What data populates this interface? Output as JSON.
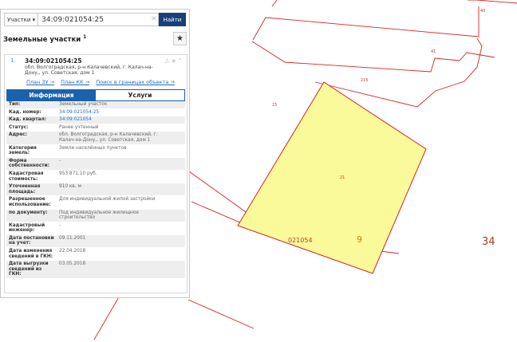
{
  "search": {
    "type_label": "Участки ▾",
    "query": "34:09:021054:25",
    "clear_glyph": "×",
    "find_label": "Найти"
  },
  "panel": {
    "title": "Земельные участки",
    "title_sup": "1",
    "star_glyph": "★"
  },
  "result": {
    "index": "1.",
    "cadastral_number": "34:09:021054:25",
    "address_lines": [
      "обл. Волгоградская, р-н Калачевский, г. Калач-на-",
      "Дону,, ул. Советская, дом 1"
    ],
    "action_icons": "⚠★⌃",
    "links": [
      "План ЗУ →",
      "План КК →",
      "Поиск в границах объекта →"
    ]
  },
  "tabs": [
    {
      "label": "Информация",
      "active": true
    },
    {
      "label": "Услуги",
      "active": false
    }
  ],
  "attributes": [
    {
      "key": [
        "Тип:"
      ],
      "value": [
        "Земельный участок"
      ],
      "link": false
    },
    {
      "key": [
        "Кад. номер:"
      ],
      "value": [
        "34:09:021054:25"
      ],
      "link": true
    },
    {
      "key": [
        "Кад. квартал:"
      ],
      "value": [
        "34:09:021054"
      ],
      "link": true
    },
    {
      "key": [
        "Статус:"
      ],
      "value": [
        "Ранее учтенный"
      ],
      "link": false
    },
    {
      "key": [
        "Адрес:"
      ],
      "value": [
        "обл. Волгоградская, р-н Калачевский, г.",
        "Калач-на-Дону,, ул. Советская, дом 1"
      ],
      "link": false
    },
    {
      "key": [
        "Категория земель:"
      ],
      "value": [
        "Земли населённых пунктов"
      ],
      "link": false
    },
    {
      "key": [
        "Форма",
        "собственности:"
      ],
      "value": [
        "-"
      ],
      "link": false
    },
    {
      "key": [
        "Кадастровая",
        "стоимость:"
      ],
      "value": [
        "953 871,10 руб."
      ],
      "link": false
    },
    {
      "key": [
        "Уточненная",
        "площадь:"
      ],
      "value": [
        "910 кв. м"
      ],
      "link": false
    },
    {
      "key": [
        "Разрешенное",
        "использование:"
      ],
      "value": [
        "Для индивидуальной жилой застройки"
      ],
      "link": false
    },
    {
      "key": [
        "по документу:"
      ],
      "value": [
        "Под индивидуальное жилищное",
        "строительство"
      ],
      "link": false
    },
    {
      "key": [
        "Кадастровый",
        "инженер:"
      ],
      "value": [
        "-"
      ],
      "link": false
    },
    {
      "key": [
        "Дата постановки",
        "на учет:"
      ],
      "value": [
        "09.11.2001"
      ],
      "link": false
    },
    {
      "key": [
        "Дата изменения",
        "сведений в ГКН:"
      ],
      "value": [
        "22.04.2018"
      ],
      "link": false
    },
    {
      "key": [
        "Дата выгрузки",
        "сведений из ГКН:"
      ],
      "value": [
        "03.05.2018"
      ],
      "link": false
    }
  ],
  "map": {
    "labels": {
      "l40": "40",
      "l41": "41",
      "l215": "215",
      "l15": "15",
      "l21": "21",
      "quarter": "021054",
      "block9": "9",
      "block34": "34"
    },
    "colors": {
      "parcel_fill": "#fbfa9a",
      "boundary": "#d42424",
      "label": "#c0392b",
      "block_label": "#b23a1a"
    }
  }
}
